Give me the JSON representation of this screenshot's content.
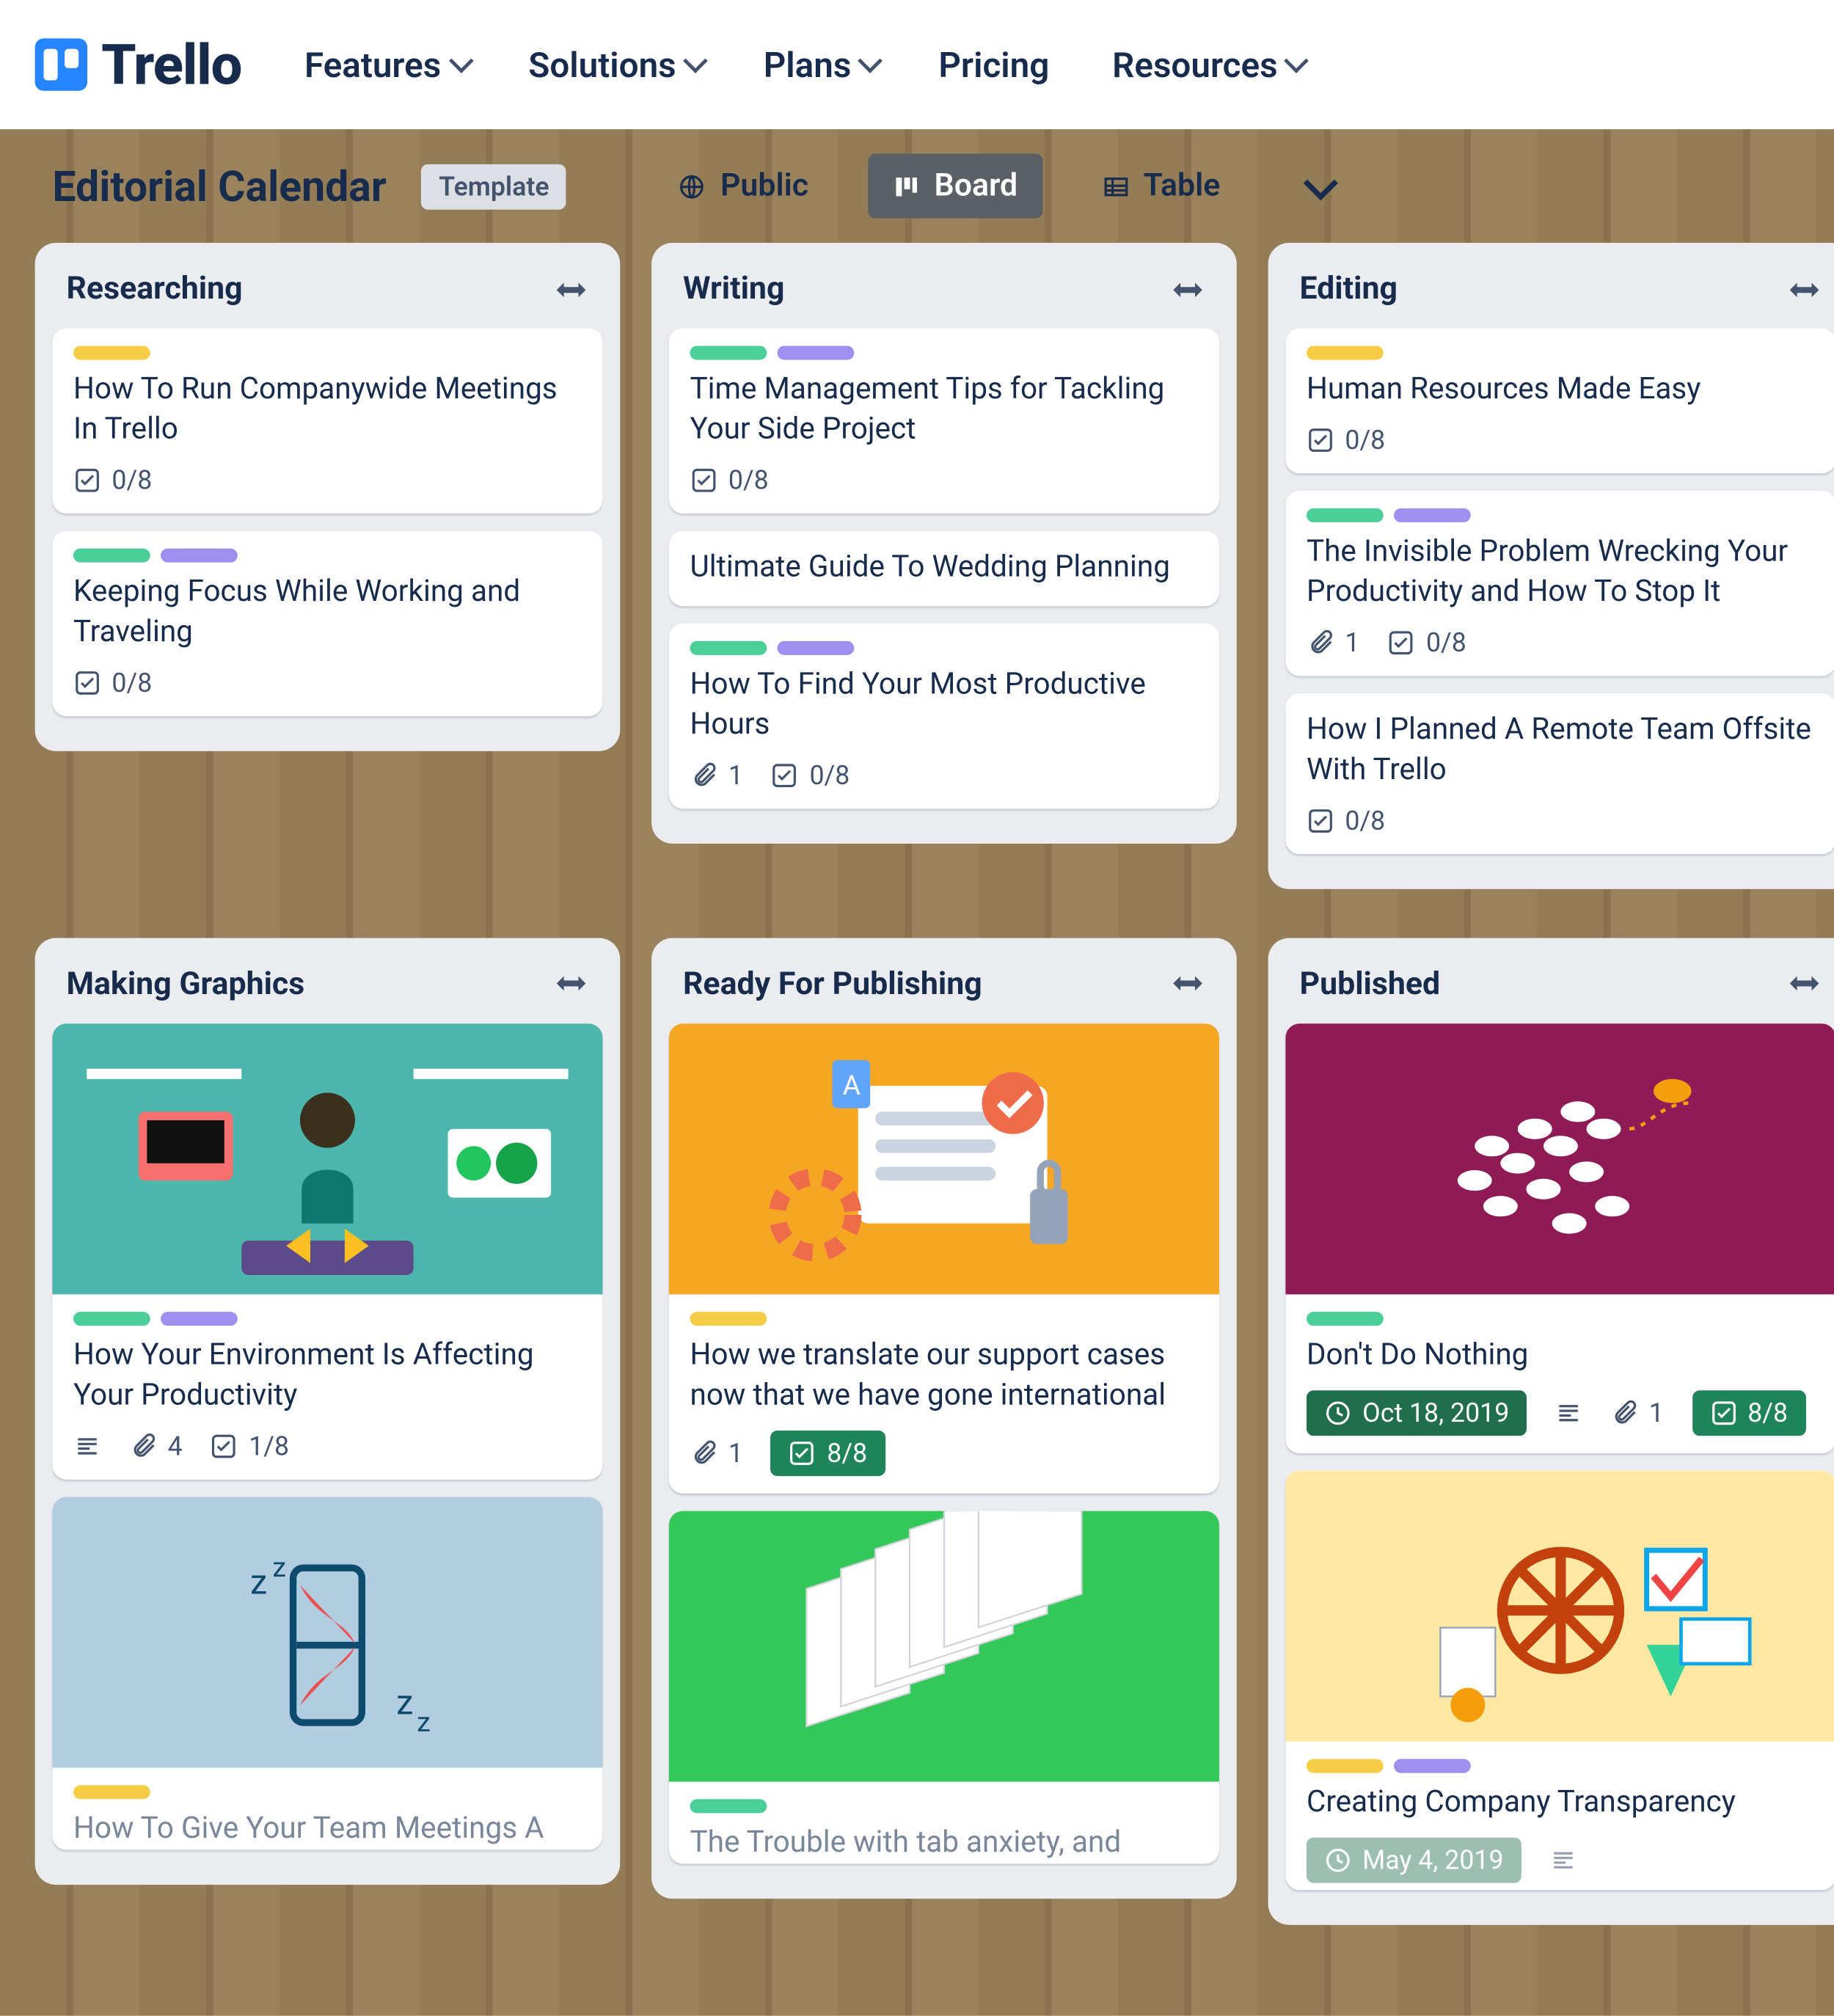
{
  "brand": "Trello",
  "nav": {
    "features": "Features",
    "solutions": "Solutions",
    "plans": "Plans",
    "pricing": "Pricing",
    "resources": "Resources"
  },
  "board": {
    "title": "Editorial Calendar",
    "template_label": "Template",
    "public_label": "Public",
    "board_view": "Board",
    "table_view": "Table"
  },
  "lists": {
    "researching": {
      "title": "Researching"
    },
    "writing": {
      "title": "Writing"
    },
    "editing": {
      "title": "Editing"
    },
    "graphics": {
      "title": "Making Graphics"
    },
    "ready": {
      "title": "Ready For Publishing"
    },
    "published": {
      "title": "Published"
    }
  },
  "cards": {
    "r1": {
      "title": "How To Run Companywide Meetings In Trello",
      "check": "0/8"
    },
    "r2": {
      "title": "Keeping Focus While Working and Traveling",
      "check": "0/8"
    },
    "w1": {
      "title": "Time Management Tips for Tackling Your Side Project",
      "check": "0/8"
    },
    "w2": {
      "title": "Ultimate Guide To Wedding Planning"
    },
    "w3": {
      "title": "How To Find Your Most Productive Hours",
      "attach": "1",
      "check": "0/8"
    },
    "e1": {
      "title": "Human Resources Made Easy",
      "check": "0/8"
    },
    "e2": {
      "title": "The Invisible Problem Wrecking Your Productivity and How To Stop It",
      "attach": "1",
      "check": "0/8"
    },
    "e3": {
      "title": "How I Planned A Remote Team Offsite With Trello",
      "check": "0/8"
    },
    "g1": {
      "title": "How Your Environment Is Affecting Your Productivity",
      "attach": "4",
      "check": "1/8"
    },
    "g2": {
      "title": "How To Give Your Team Meetings A"
    },
    "p1": {
      "title": "How we translate our support cases now that we have gone international",
      "attach": "1",
      "check": "8/8"
    },
    "p2": {
      "title": "The Trouble with tab anxiety, and"
    },
    "pub1": {
      "title": "Don't Do Nothing",
      "date": "Oct 18, 2019",
      "attach": "1",
      "check": "8/8"
    },
    "pub2": {
      "title": "Creating Company Transparency",
      "date": "May 4, 2019"
    }
  }
}
